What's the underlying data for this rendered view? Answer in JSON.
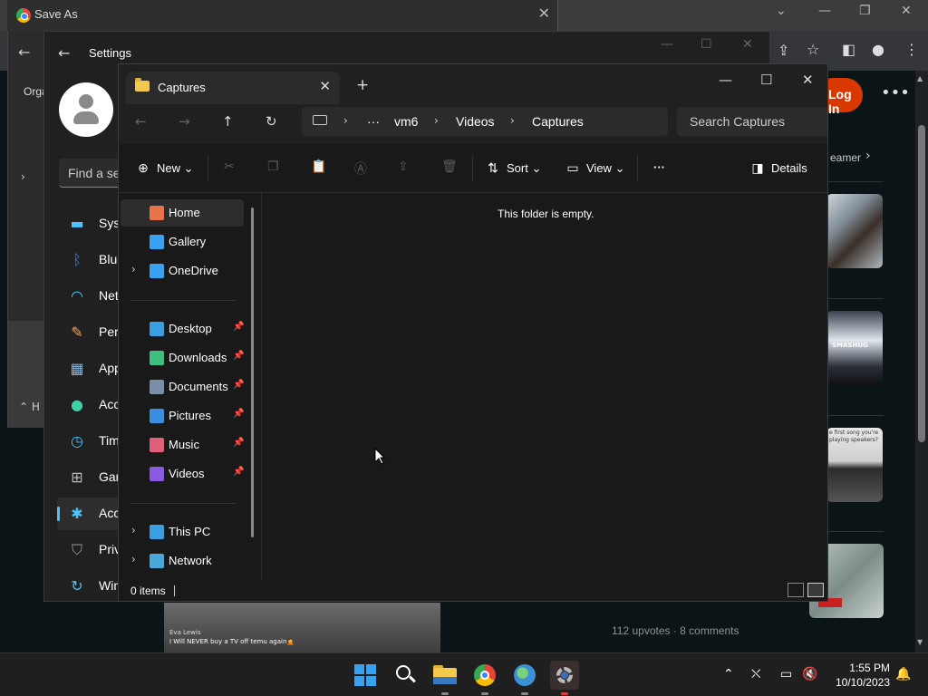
{
  "browser": {
    "tab_title": "Save As",
    "login_label": "Log In",
    "streamer_label": "eamer",
    "thumbnail_labels": {
      "samsung_text": "SMASHUG",
      "song_text": "e first song you're playing speakers?"
    },
    "post_stats": "112 upvotes · 8 comments"
  },
  "video_overlay": {
    "author": "Eva Lewis",
    "caption": "I Will NEVER buy a TV off temu again🤦"
  },
  "save_as": {
    "organize_label": "Orga",
    "hide_label": "H"
  },
  "settings": {
    "title": "Settings",
    "find_placeholder": "Find a se",
    "nav_items": [
      {
        "label": "Syst",
        "icon": "monitor-icon",
        "color": "#4cc2ff"
      },
      {
        "label": "Blue",
        "icon": "bluetooth-icon",
        "color": "#2f7fe0"
      },
      {
        "label": "Net",
        "icon": "wifi-icon",
        "color": "#4cc2ff"
      },
      {
        "label": "Pers",
        "icon": "brush-icon",
        "color": "#e8a86a"
      },
      {
        "label": "App",
        "icon": "apps-icon",
        "color": "#8ab4d8"
      },
      {
        "label": "Acc",
        "icon": "accounts-icon",
        "color": "#3fd1a8"
      },
      {
        "label": "Tim",
        "icon": "clock-icon",
        "color": "#4cc2ff"
      },
      {
        "label": "Gar",
        "icon": "gamepad-icon",
        "color": "#bbbbbb"
      },
      {
        "label": "Acc",
        "icon": "accessibility-icon",
        "color": "#4cc2ff"
      },
      {
        "label": "Priv",
        "icon": "shield-icon",
        "color": "#9a9a9a"
      },
      {
        "label": "Win",
        "icon": "update-icon",
        "color": "#4cc2ff"
      }
    ]
  },
  "explorer": {
    "tab_label": "Captures",
    "breadcrumb": [
      "···",
      "vm6",
      "Videos",
      "Captures"
    ],
    "search_placeholder": "Search Captures",
    "commands": {
      "new_label": "New",
      "sort_label": "Sort",
      "view_label": "View",
      "more_label": "···",
      "details_label": "Details"
    },
    "nav_top": [
      {
        "label": "Home",
        "color": "#e8734a",
        "selected": true
      },
      {
        "label": "Gallery",
        "color": "#3aa0f0"
      },
      {
        "label": "OneDrive",
        "color": "#3aa0f0",
        "expandable": true
      }
    ],
    "nav_quick": [
      {
        "label": "Desktop",
        "color": "#3a9ee0"
      },
      {
        "label": "Downloads",
        "color": "#3fbf7f"
      },
      {
        "label": "Documents",
        "color": "#7a8ea8"
      },
      {
        "label": "Pictures",
        "color": "#3a8ee0"
      },
      {
        "label": "Music",
        "color": "#e0607a"
      },
      {
        "label": "Videos",
        "color": "#8a5ae0"
      }
    ],
    "nav_bottom": [
      {
        "label": "This PC",
        "color": "#3a9ee0"
      },
      {
        "label": "Network",
        "color": "#4aa8d8"
      }
    ],
    "empty_message": "This folder is empty.",
    "status_count": "0 items"
  },
  "taskbar": {
    "time": "1:55 PM",
    "date": "10/10/2023"
  }
}
